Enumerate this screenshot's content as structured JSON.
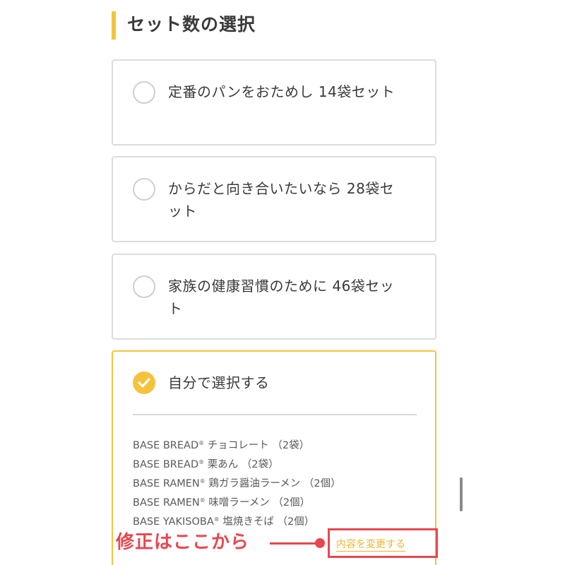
{
  "section": {
    "title": "セット数の選択"
  },
  "options": [
    {
      "label": "定番のパンをおためし 14袋セット",
      "selected": false
    },
    {
      "label": "からだと向き合いたいなら 28袋セット",
      "selected": false
    },
    {
      "label": "家族の健康習慣のために 46袋セット",
      "selected": false
    },
    {
      "label": "自分で選択する",
      "selected": true
    }
  ],
  "custom_items": [
    {
      "brand": "BASE BREAD",
      "mark": "®",
      "name": "チョコレート",
      "qty": "（2袋）"
    },
    {
      "brand": "BASE BREAD",
      "mark": "®",
      "name": "栗あん",
      "qty": "（2袋）"
    },
    {
      "brand": "BASE RAMEN",
      "mark": "®",
      "name": "鶏ガラ醤油ラーメン",
      "qty": "（2個）"
    },
    {
      "brand": "BASE RAMEN",
      "mark": "®",
      "name": "味噌ラーメン",
      "qty": "（2個）"
    },
    {
      "brand": "BASE YAKISOBA",
      "mark": "®",
      "name": "塩焼きそば",
      "qty": "（2個）"
    }
  ],
  "change_link": "内容を変更する",
  "annotation": {
    "label": "修正はここから"
  },
  "colors": {
    "accent": "#f5c33b",
    "annotation": "#e8474f",
    "border": "#dcdcdc",
    "text": "#3a3a3a"
  },
  "icons": {
    "selected": "check-icon"
  }
}
